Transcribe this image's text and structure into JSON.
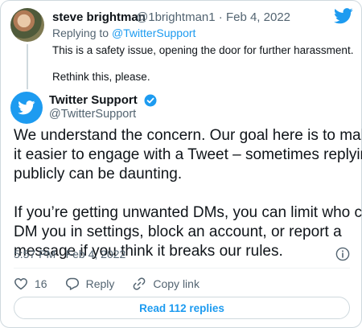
{
  "reply": {
    "author_name": "steve brightman",
    "author_handle_date": "@1brightman1 · Feb 4, 2022",
    "replying_to_prefix": "Replying to ",
    "replying_to_mention": "@TwitterSupport",
    "text_line1": "This is a safety issue, opening the door for further harassment.",
    "text_line2": "Rethink this, please."
  },
  "tweet": {
    "author_name": "Twitter Support",
    "author_handle": "@TwitterSupport",
    "para1_lines": [
      "We understand the concern. Our goal here is to make",
      "it easier to engage with a Tweet – sometimes replying",
      "publicly can be daunting."
    ],
    "para2_lines": [
      "If you’re getting unwanted DMs, you can limit who can",
      "DM you in settings, block an account, or report a",
      "message if you think it breaks our rules."
    ],
    "timestamp": "5:57 PM · Feb 4, 2022"
  },
  "actions": {
    "like_count": "16",
    "reply_label": "Reply",
    "copy_link_label": "Copy link"
  },
  "read_replies_label": "Read 112 replies",
  "colors": {
    "accent": "#1d9bf0",
    "secondary_text": "#536471",
    "border": "#cfd9de"
  },
  "icons": [
    "twitter-bird-icon",
    "verified-badge-icon",
    "info-icon",
    "heart-icon",
    "reply-bubble-icon",
    "link-icon"
  ]
}
